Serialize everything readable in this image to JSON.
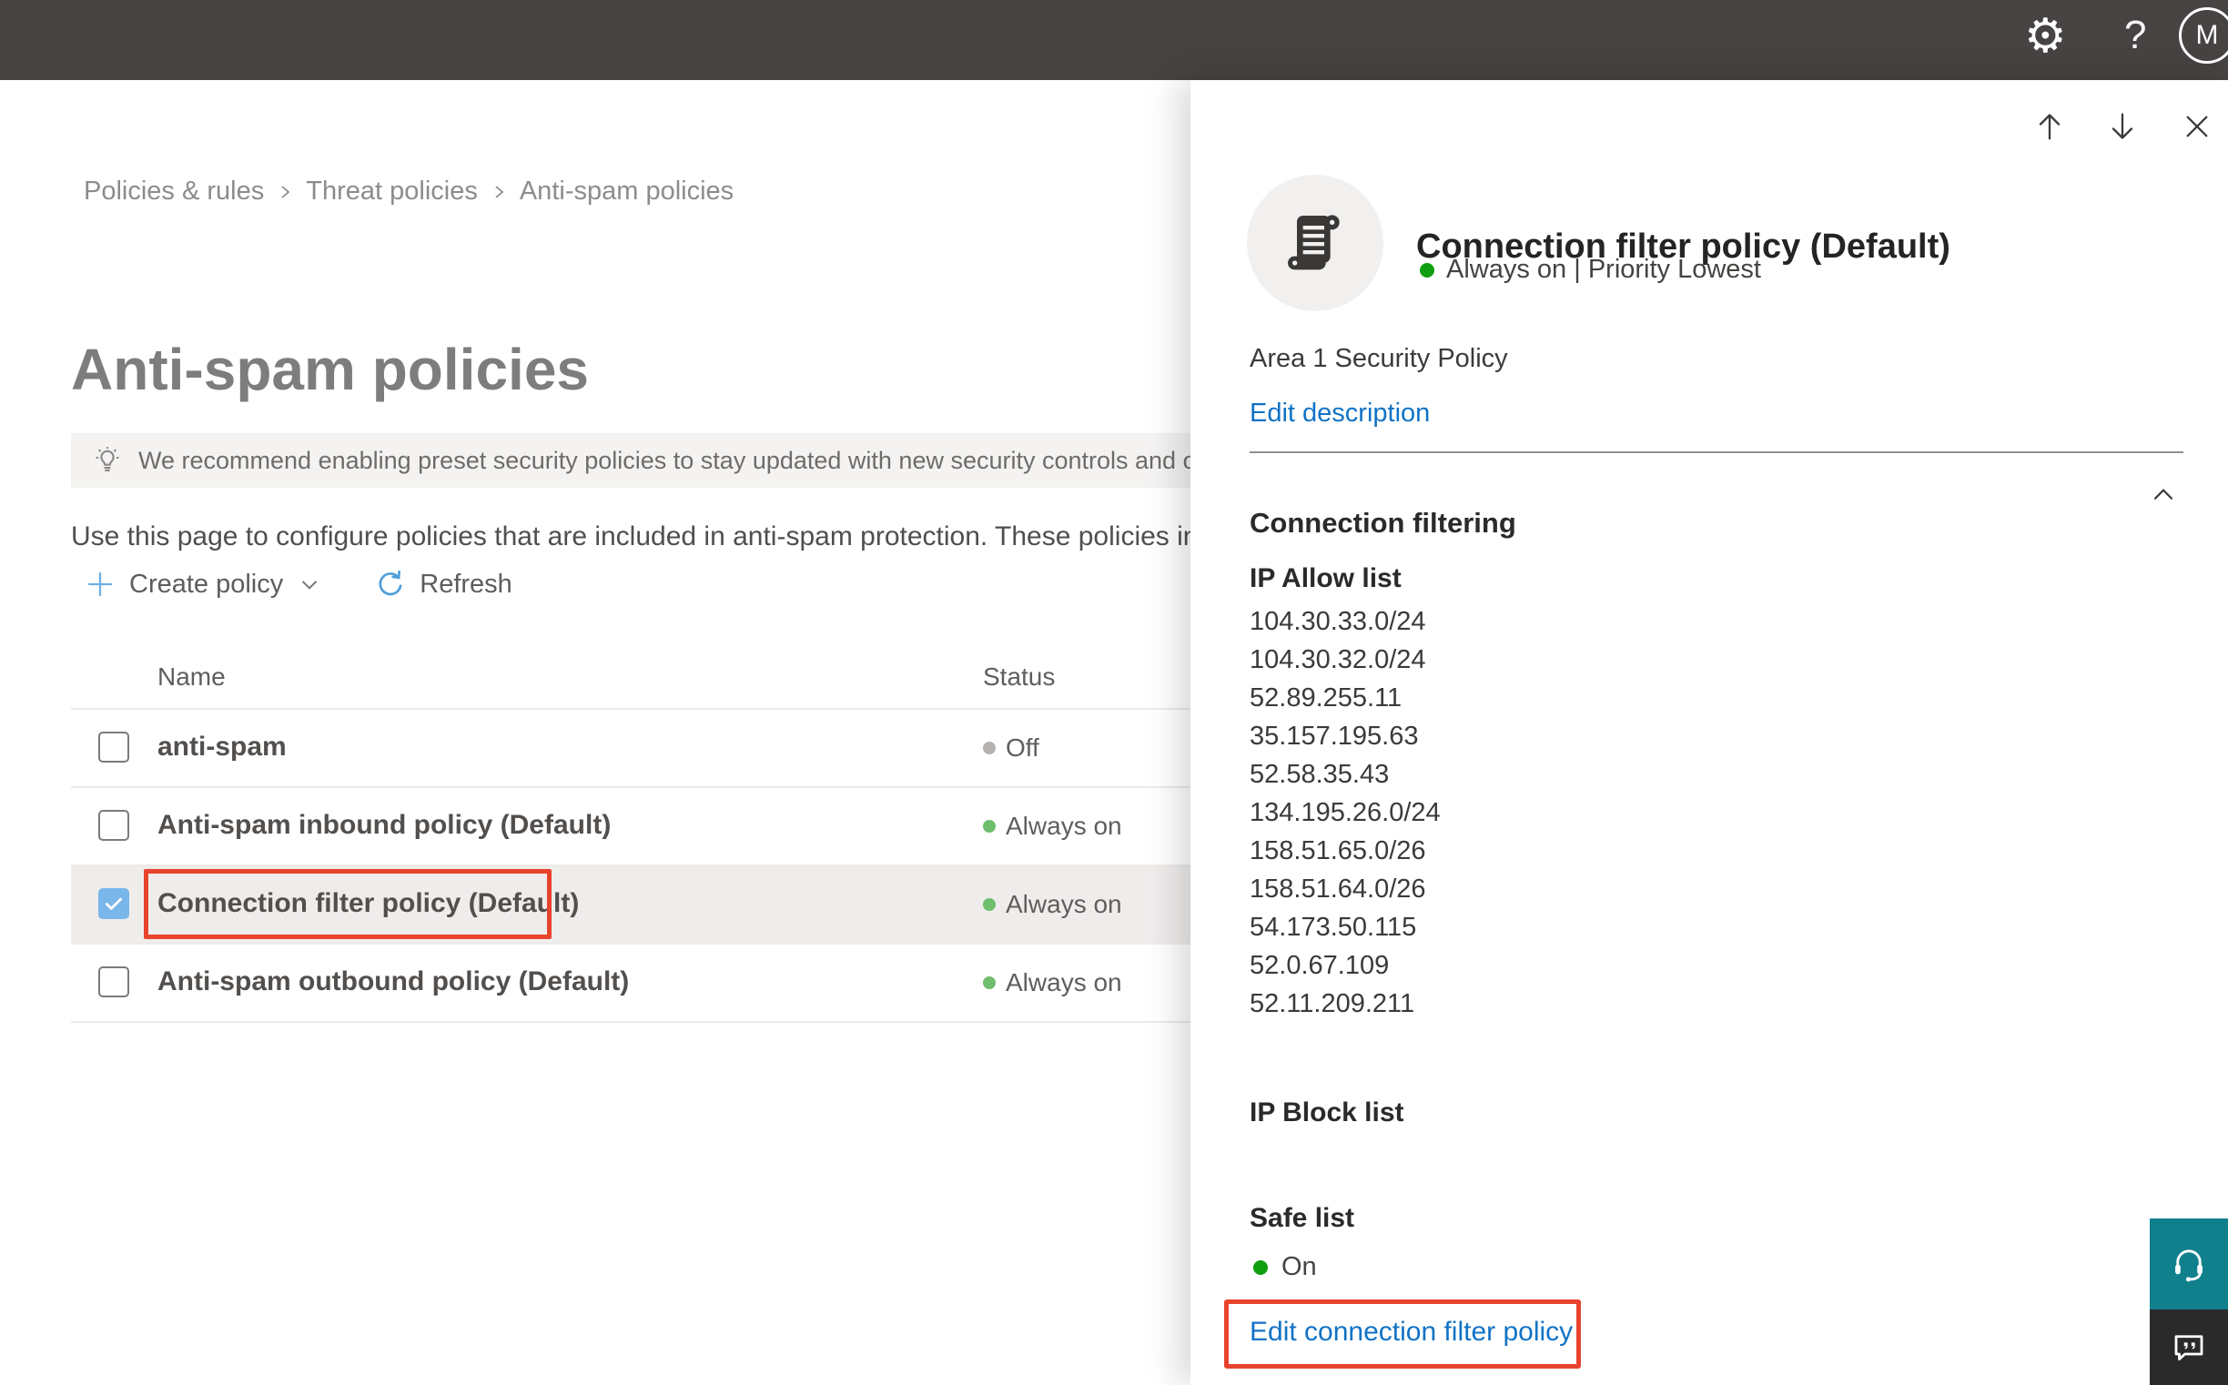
{
  "colors": {
    "topbar-bg": "#464342",
    "link-blue": "#1173c5",
    "status-green": "#6fbe6e",
    "status-green-bright": "#0f9e0f",
    "status-gray": "#b5b3b1",
    "annotation-red": "#e8432d",
    "checkbox-blue": "#79b6ea",
    "teal": "#11808d"
  },
  "topbar": {
    "help_label": "?",
    "avatar_initial": "M"
  },
  "breadcrumb": {
    "items": [
      "Policies & rules",
      "Threat policies",
      "Anti-spam policies"
    ]
  },
  "page": {
    "title": "Anti-spam policies",
    "banner_text": "We recommend enabling preset security policies to stay updated with new security controls and our recomme",
    "intro_text": "Use this page to configure policies that are included in anti-spam protection. These policies include"
  },
  "toolbar": {
    "create_policy_label": "Create policy",
    "refresh_label": "Refresh"
  },
  "policy_table": {
    "columns": {
      "name": "Name",
      "status": "Status"
    },
    "rows": [
      {
        "name": "anti-spam",
        "status": "Off",
        "status_color": "gray",
        "checked_class": "",
        "row_class": ""
      },
      {
        "name": "Anti-spam inbound policy (Default)",
        "status": "Always on",
        "status_color": "green",
        "checked_class": "",
        "row_class": ""
      },
      {
        "name": "Connection filter policy (Default)",
        "status": "Always on",
        "status_color": "green",
        "checked_class": "checked",
        "row_class": "selected"
      },
      {
        "name": "Anti-spam outbound policy (Default)",
        "status": "Always on",
        "status_color": "green",
        "checked_class": "",
        "row_class": ""
      }
    ]
  },
  "flyout": {
    "title": "Connection filter policy (Default)",
    "status_line": "Always on | Priority Lowest",
    "status_dot": "bright",
    "description": "Area 1 Security Policy",
    "edit_description_label": "Edit description",
    "section_title": "Connection filtering",
    "ip_allow_label": "IP Allow list",
    "ip_allow_list": [
      "104.30.33.0/24",
      "104.30.32.0/24",
      "52.89.255.11",
      "35.157.195.63",
      "52.58.35.43",
      "134.195.26.0/24",
      "158.51.65.0/26",
      "158.51.64.0/26",
      "54.173.50.115",
      "52.0.67.109",
      "52.11.209.211"
    ],
    "ip_block_label": "IP Block list",
    "safe_list_label": "Safe list",
    "safe_list_status": "On",
    "safe_dot": "bright",
    "edit_link_label": "Edit connection filter policy"
  }
}
